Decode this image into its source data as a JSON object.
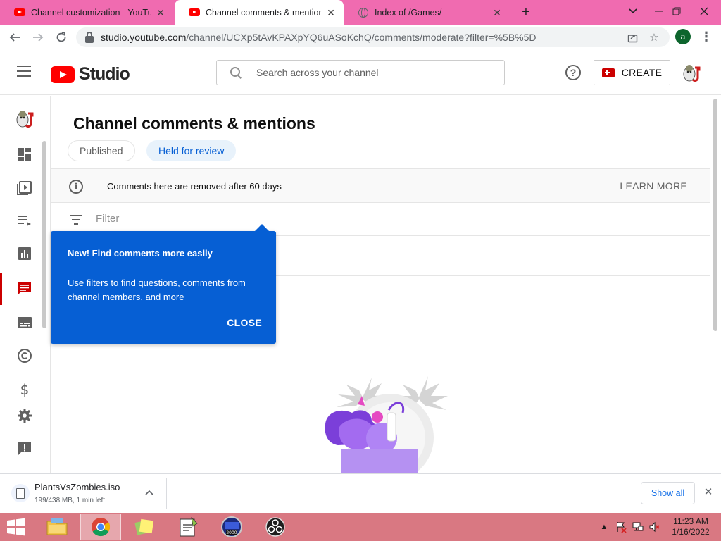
{
  "browser": {
    "tabs": [
      {
        "title": "Channel customization - YouTube",
        "icon": "youtube-favicon",
        "active": false
      },
      {
        "title": "Channel comments & mentions",
        "icon": "youtube-favicon",
        "active": true
      },
      {
        "title": "Index of /Games/",
        "icon": "globe-favicon",
        "active": false
      }
    ],
    "url_host": "studio.youtube.com",
    "url_path": "/channel/UCXp5tAvKPAXpYQ6uASoKchQ/comments/moderate?filter=%5B%5D",
    "profile_letter": "a"
  },
  "header": {
    "logo_text": "Studio",
    "search_placeholder": "Search across your channel",
    "create_label": "CREATE",
    "help_icon": "?"
  },
  "sidebar": {
    "items": [
      {
        "name": "dashboard",
        "icon": "dashboard-icon"
      },
      {
        "name": "content",
        "icon": "content-icon"
      },
      {
        "name": "playlists",
        "icon": "playlists-icon"
      },
      {
        "name": "analytics",
        "icon": "analytics-icon"
      },
      {
        "name": "comments",
        "icon": "comments-icon",
        "active": true
      },
      {
        "name": "subtitles",
        "icon": "subtitles-icon"
      },
      {
        "name": "copyright",
        "icon": "copyright-icon"
      },
      {
        "name": "monetization",
        "icon": "dollar-icon"
      },
      {
        "name": "settings",
        "icon": "gear-icon"
      },
      {
        "name": "feedback",
        "icon": "feedback-icon"
      }
    ]
  },
  "main": {
    "title": "Channel comments & mentions",
    "tabs": [
      {
        "label": "Published",
        "selected": false
      },
      {
        "label": "Held for review",
        "selected": true
      }
    ],
    "notice": {
      "text": "Comments here are removed after 60 days",
      "link": "LEARN MORE"
    },
    "filter_label": "Filter"
  },
  "tooltip": {
    "title": "New! Find comments more easily",
    "body": "Use filters to find questions, comments from channel members, and more",
    "close_label": "CLOSE"
  },
  "download_bar": {
    "file_name": "PlantsVsZombies.iso",
    "status": "199/438 MB, 1 min left",
    "show_all_label": "Show all"
  },
  "taskbar": {
    "time": "11:23 AM",
    "date": "1/16/2022"
  },
  "colors": {
    "tabstrip": "#f06bb0",
    "taskbar": "#d97882",
    "accent_blue": "#065fd4",
    "youtube_red": "#ff0000"
  }
}
